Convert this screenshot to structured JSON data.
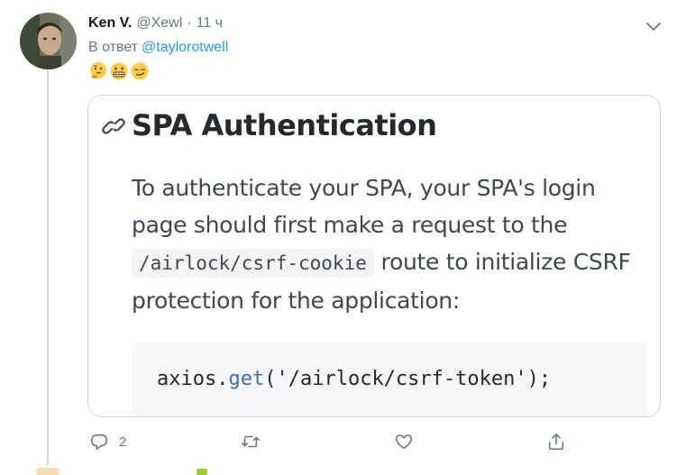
{
  "tweet": {
    "author_name": "Ken V.",
    "author_handle": "@Xewl",
    "separator": "·",
    "time": "11 ч",
    "reply_prefix": "В ответ",
    "reply_to": "@taylorotwell",
    "emoji_names": [
      "thinking-face-emoji",
      "grimacing-face-emoji",
      "smirking-face-emoji"
    ]
  },
  "card": {
    "title": "SPA Authentication",
    "paragraph_before": "To authenticate your SPA, your SPA's login page should first make a request to the",
    "paragraph_code": "/airlock/csrf-cookie",
    "paragraph_after": "route to initialize CSRF protection for the application:",
    "code_object": "axios.",
    "code_method": "get",
    "code_args": "('/airlock/csrf-token');"
  },
  "actions": {
    "reply_count": "2"
  },
  "colors": {
    "accent": "#1da1f2",
    "muted": "#657786",
    "border": "#ccd6dd",
    "doc_text": "#3d4852",
    "code_method": "#3b6cb5"
  }
}
